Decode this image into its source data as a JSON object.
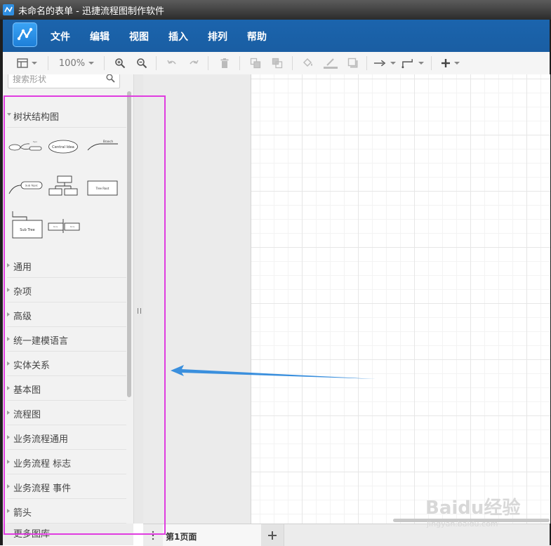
{
  "window": {
    "title": "未命名的表单 - 迅捷流程图制作软件"
  },
  "menu": {
    "items": [
      {
        "label": "文件"
      },
      {
        "label": "编辑"
      },
      {
        "label": "视图"
      },
      {
        "label": "插入"
      },
      {
        "label": "排列"
      },
      {
        "label": "帮助"
      }
    ]
  },
  "toolbar": {
    "zoom": "100%",
    "icons": [
      "page-view-icon",
      "zoom-in-icon",
      "zoom-out-icon",
      "undo-icon",
      "redo-icon",
      "delete-icon",
      "to-front-icon",
      "to-back-icon",
      "fill-color-icon",
      "line-color-icon",
      "shadow-icon",
      "connection-icon",
      "waypoints-icon",
      "insert-plus-icon"
    ]
  },
  "sidebar": {
    "search_placeholder": "搜索形状",
    "open_section": {
      "label": "树状结构图"
    },
    "tree_shapes": [
      {
        "name": "mind-map-shape",
        "label": ""
      },
      {
        "name": "central-idea-shape",
        "label": "Central Idea"
      },
      {
        "name": "branch-shape",
        "label": "Branch"
      },
      {
        "name": "sub-topic-shape",
        "label": "Sub Topic"
      },
      {
        "name": "org-chart-shape",
        "label": ""
      },
      {
        "name": "tree-root-shape",
        "label": "Tree Root"
      },
      {
        "name": "sub-tree-shape",
        "label": "Sub Tree"
      },
      {
        "name": "horizontal-tree-shape",
        "label": ""
      }
    ],
    "sections": [
      {
        "label": "通用"
      },
      {
        "label": "杂项"
      },
      {
        "label": "高级"
      },
      {
        "label": "统一建模语言"
      },
      {
        "label": "实体关系"
      },
      {
        "label": "基本图"
      },
      {
        "label": "流程图"
      },
      {
        "label": "业务流程通用"
      },
      {
        "label": "业务流程 标志"
      },
      {
        "label": "业务流程 事件"
      },
      {
        "label": "箭头"
      }
    ],
    "more_libraries": "更多图库"
  },
  "bottom": {
    "page_tab": "第1页面",
    "add_page": "+"
  },
  "watermark": {
    "line1": "Baidu经验",
    "line2": "jingyan.baidu.com"
  },
  "colors": {
    "menubar": "#1a5ea3",
    "highlight": "#e03ce0",
    "annotation_arrow": "#3a8fdd"
  }
}
